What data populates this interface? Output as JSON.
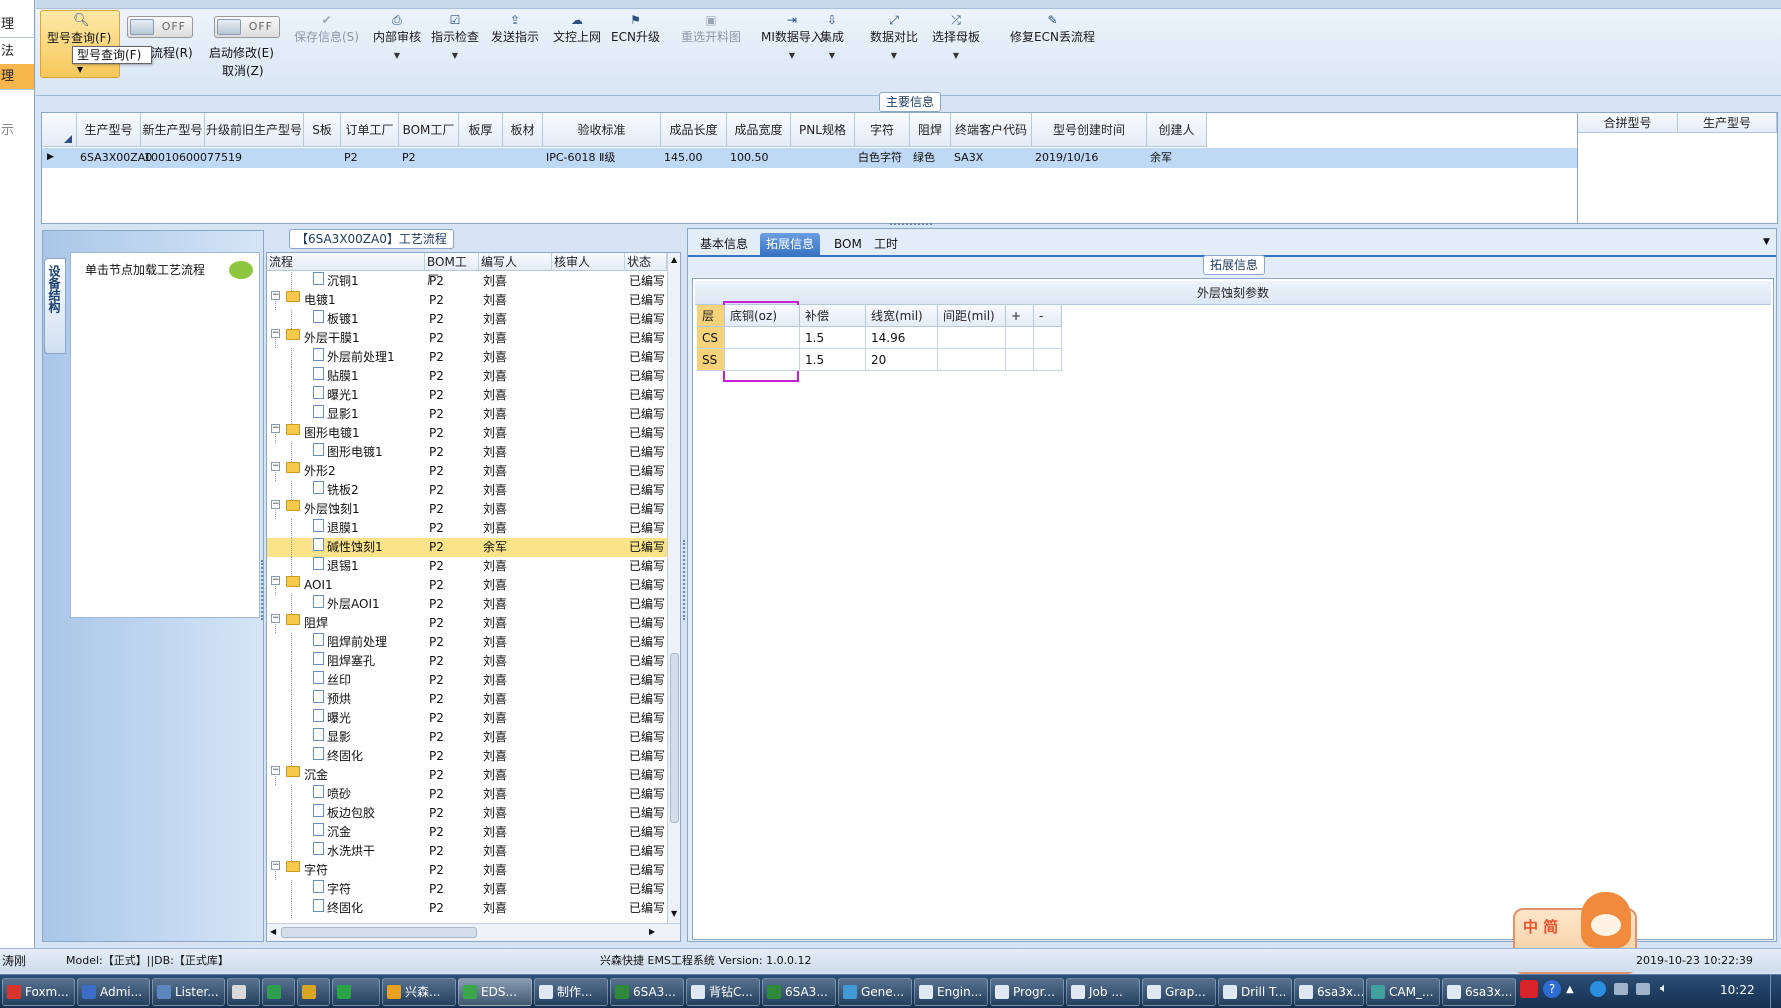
{
  "left_strip": {
    "items": [
      "理",
      "法",
      "理",
      "示"
    ]
  },
  "toolbar": {
    "model_query": "型号查询(F)",
    "tooltip": "型号查询(F)",
    "toggle1_label": "OFF",
    "toggle2_label": "OFF",
    "flow_label": "流程(R)",
    "start_edit": "启动修改(E)",
    "cancel": "取消(Z)",
    "buttons": [
      {
        "label": "保存信息(S)",
        "glyph": "✔",
        "disabled": true
      },
      {
        "label": "内部审核",
        "glyph": "⎙",
        "disabled": false
      },
      {
        "label": "指示检查",
        "glyph": "☑",
        "disabled": false
      },
      {
        "label": "发送指示",
        "glyph": "⇪",
        "disabled": false
      },
      {
        "label": "文控上网",
        "glyph": "☁",
        "disabled": false
      },
      {
        "label": "ECN升级",
        "glyph": "⚑",
        "disabled": false
      },
      {
        "label": "重选开料图",
        "glyph": "▣",
        "disabled": true
      },
      {
        "label": "MI数据导入",
        "glyph": "⇥",
        "disabled": false
      },
      {
        "label": "集成",
        "glyph": "⇩",
        "disabled": false
      },
      {
        "label": "数据对比",
        "glyph": "⤢",
        "disabled": false
      },
      {
        "label": "选择母板",
        "glyph": "⤮",
        "disabled": false
      },
      {
        "label": "修复ECN丢流程",
        "glyph": "✎",
        "disabled": false
      }
    ]
  },
  "main_info": {
    "title": "主要信息",
    "columns": [
      "生产型号",
      "新生产型号",
      "升级前旧生产型号",
      "S板",
      "订单工厂",
      "BOM工厂",
      "板厚",
      "板材",
      "验收标准",
      "成品长度",
      "成品宽度",
      "PNL规格",
      "字符",
      "阻焊",
      "终端客户代码",
      "型号创建时间",
      "创建人"
    ],
    "row": [
      "6SA3X00ZA0",
      "10010600077519",
      "",
      "",
      "P2",
      "P2",
      "",
      "",
      "IPC-6018 Ⅱ级",
      "145.00",
      "100.50",
      "",
      "白色字符",
      "绿色",
      "SA3X",
      "2019/10/16",
      "余军"
    ],
    "side_columns": [
      "合拼型号",
      "生产型号"
    ]
  },
  "dept": {
    "tab": "设备结构",
    "hint": "单击节点加载工艺流程"
  },
  "process": {
    "title": "【6SA3X00ZA0】工艺流程",
    "columns": [
      "流程",
      "BOM工厂",
      "编写人",
      "核审人",
      "状态"
    ],
    "rows": [
      {
        "name": "沉铜1",
        "level": 2,
        "type": "doc",
        "bom": "P2",
        "writer": "刘喜",
        "status": "已编写"
      },
      {
        "name": "电镀1",
        "level": 1,
        "type": "folder",
        "bom": "P2",
        "writer": "刘喜",
        "status": "已编写"
      },
      {
        "name": "板镀1",
        "level": 2,
        "type": "doc",
        "bom": "P2",
        "writer": "刘喜",
        "status": "已编写"
      },
      {
        "name": "外层干膜1",
        "level": 1,
        "type": "folder",
        "bom": "P2",
        "writer": "刘喜",
        "status": "已编写"
      },
      {
        "name": "外层前处理1",
        "level": 2,
        "type": "doc",
        "bom": "P2",
        "writer": "刘喜",
        "status": "已编写"
      },
      {
        "name": "贴膜1",
        "level": 2,
        "type": "doc",
        "bom": "P2",
        "writer": "刘喜",
        "status": "已编写"
      },
      {
        "name": "曝光1",
        "level": 2,
        "type": "doc",
        "bom": "P2",
        "writer": "刘喜",
        "status": "已编写"
      },
      {
        "name": "显影1",
        "level": 2,
        "type": "doc",
        "bom": "P2",
        "writer": "刘喜",
        "status": "已编写"
      },
      {
        "name": "图形电镀1",
        "level": 1,
        "type": "folder",
        "bom": "P2",
        "writer": "刘喜",
        "status": "已编写"
      },
      {
        "name": "图形电镀1",
        "level": 2,
        "type": "doc",
        "bom": "P2",
        "writer": "刘喜",
        "status": "已编写"
      },
      {
        "name": "外形2",
        "level": 1,
        "type": "folder",
        "bom": "P2",
        "writer": "刘喜",
        "status": "已编写"
      },
      {
        "name": "铣板2",
        "level": 2,
        "type": "doc",
        "bom": "P2",
        "writer": "刘喜",
        "status": "已编写"
      },
      {
        "name": "外层蚀刻1",
        "level": 1,
        "type": "folder",
        "bom": "P2",
        "writer": "刘喜",
        "status": "已编写"
      },
      {
        "name": "退膜1",
        "level": 2,
        "type": "doc",
        "bom": "P2",
        "writer": "刘喜",
        "status": "已编写"
      },
      {
        "name": "碱性蚀刻1",
        "level": 2,
        "type": "doc",
        "bom": "P2",
        "writer": "余军",
        "status": "已编写",
        "selected": true
      },
      {
        "name": "退锡1",
        "level": 2,
        "type": "doc",
        "bom": "P2",
        "writer": "刘喜",
        "status": "已编写"
      },
      {
        "name": "AOI1",
        "level": 1,
        "type": "folder",
        "bom": "P2",
        "writer": "刘喜",
        "status": "已编写"
      },
      {
        "name": "外层AOI1",
        "level": 2,
        "type": "doc",
        "bom": "P2",
        "writer": "刘喜",
        "status": "已编写"
      },
      {
        "name": "阻焊",
        "level": 1,
        "type": "folder",
        "bom": "P2",
        "writer": "刘喜",
        "status": "已编写"
      },
      {
        "name": "阻焊前处理",
        "level": 2,
        "type": "doc",
        "bom": "P2",
        "writer": "刘喜",
        "status": "已编写"
      },
      {
        "name": "阻焊塞孔",
        "level": 2,
        "type": "doc",
        "bom": "P2",
        "writer": "刘喜",
        "status": "已编写"
      },
      {
        "name": "丝印",
        "level": 2,
        "type": "doc",
        "bom": "P2",
        "writer": "刘喜",
        "status": "已编写"
      },
      {
        "name": "预烘",
        "level": 2,
        "type": "doc",
        "bom": "P2",
        "writer": "刘喜",
        "status": "已编写"
      },
      {
        "name": "曝光",
        "level": 2,
        "type": "doc",
        "bom": "P2",
        "writer": "刘喜",
        "status": "已编写"
      },
      {
        "name": "显影",
        "level": 2,
        "type": "doc",
        "bom": "P2",
        "writer": "刘喜",
        "status": "已编写"
      },
      {
        "name": "终固化",
        "level": 2,
        "type": "doc",
        "bom": "P2",
        "writer": "刘喜",
        "status": "已编写"
      },
      {
        "name": "沉金",
        "level": 1,
        "type": "folder",
        "bom": "P2",
        "writer": "刘喜",
        "status": "已编写"
      },
      {
        "name": "喷砂",
        "level": 2,
        "type": "doc",
        "bom": "P2",
        "writer": "刘喜",
        "status": "已编写"
      },
      {
        "name": "板边包胶",
        "level": 2,
        "type": "doc",
        "bom": "P2",
        "writer": "刘喜",
        "status": "已编写"
      },
      {
        "name": "沉金",
        "level": 2,
        "type": "doc",
        "bom": "P2",
        "writer": "刘喜",
        "status": "已编写"
      },
      {
        "name": "水洗烘干",
        "level": 2,
        "type": "doc",
        "bom": "P2",
        "writer": "刘喜",
        "status": "已编写"
      },
      {
        "name": "字符",
        "level": 1,
        "type": "folder",
        "bom": "P2",
        "writer": "刘喜",
        "status": "已编写"
      },
      {
        "name": "字符",
        "level": 2,
        "type": "doc",
        "bom": "P2",
        "writer": "刘喜",
        "status": "已编写"
      },
      {
        "name": "终固化",
        "level": 2,
        "type": "doc",
        "bom": "P2",
        "writer": "刘喜",
        "status": "已编写"
      }
    ]
  },
  "right": {
    "tabs": [
      "基本信息",
      "拓展信息",
      "BOM",
      "工时"
    ],
    "active_tab": 1,
    "ext_title": "拓展信息",
    "grid_title": "外层蚀刻参数",
    "columns": [
      "层",
      "底铜(oz)",
      "补偿",
      "线宽(mil)",
      "间距(mil)",
      "+",
      "-"
    ],
    "rows": [
      [
        "CS",
        "",
        "1.5",
        "14.96",
        "",
        ""
      ],
      [
        "SS",
        "",
        "1.5",
        "20",
        "",
        ""
      ]
    ],
    "highlight_color": "#c81fd0"
  },
  "status": {
    "left": "涛刚",
    "model": "Model:【正式】||DB:【正式库】",
    "app": "兴森快捷 EMS工程系统 Version: 1.0.0.12",
    "mascot": "中 简",
    "datetime": "2019-10-23 10:22:39"
  },
  "taskbar": {
    "tasks": [
      {
        "label": "Foxm...",
        "color": "#d9342b"
      },
      {
        "label": "Admi...",
        "color": "#3c6ec8"
      },
      {
        "label": "Lister...",
        "color": "#5d86c0"
      },
      {
        "label": "",
        "color": "#d9d9d9"
      },
      {
        "label": "",
        "color": "#2f9e4f"
      },
      {
        "label": "",
        "color": "#d6a624"
      },
      {
        "label": "",
        "color": "#27a349"
      },
      {
        "label": "兴森...",
        "color": "#e8a020"
      },
      {
        "label": "EDS...",
        "color": "#3aa74a"
      },
      {
        "label": "制作...",
        "color": "#dfe7f3"
      },
      {
        "label": "6SA3...",
        "color": "#2f8a3c"
      },
      {
        "label": "背钻C...",
        "color": "#dfe7f3"
      },
      {
        "label": "6SA3...",
        "color": "#2f8a3c"
      },
      {
        "label": "Gene...",
        "color": "#3f9ad6"
      },
      {
        "label": "Engin...",
        "color": "#dfe7f3"
      },
      {
        "label": "Progr...",
        "color": "#dfe7f3"
      },
      {
        "label": "Job ...",
        "color": "#dfe7f3"
      },
      {
        "label": "Grap...",
        "color": "#dfe7f3"
      },
      {
        "label": "Drill T...",
        "color": "#dfe7f3"
      },
      {
        "label": "6sa3x...",
        "color": "#dfe7f3"
      },
      {
        "label": "CAM_...",
        "color": "#3fa2a0"
      },
      {
        "label": "6sa3x...",
        "color": "#dfe7f3"
      }
    ],
    "time": "10:22"
  }
}
